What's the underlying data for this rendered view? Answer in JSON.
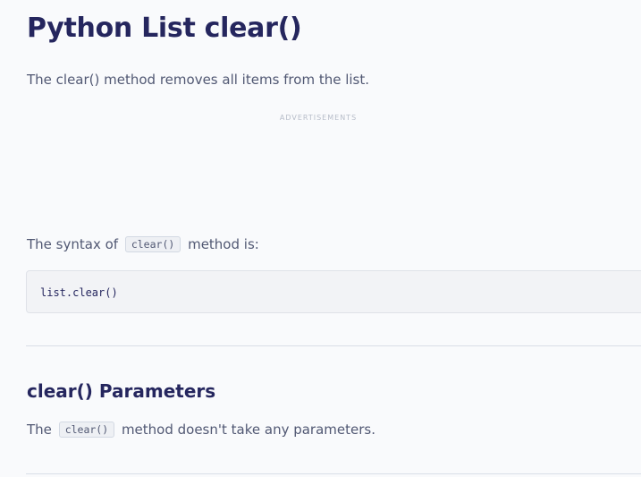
{
  "article": {
    "title": "Python List clear()",
    "intro": "The clear() method removes all items from the list.",
    "ad_label": "ADVERTISEMENTS",
    "syntax": {
      "text_before": "The syntax of",
      "code": "clear()",
      "text_after": "method is:"
    },
    "code_block": "list.clear()",
    "parameters_section": {
      "heading": "clear() Parameters",
      "text_before": "The",
      "code": "clear()",
      "text_after": "method doesn't take any parameters."
    }
  }
}
